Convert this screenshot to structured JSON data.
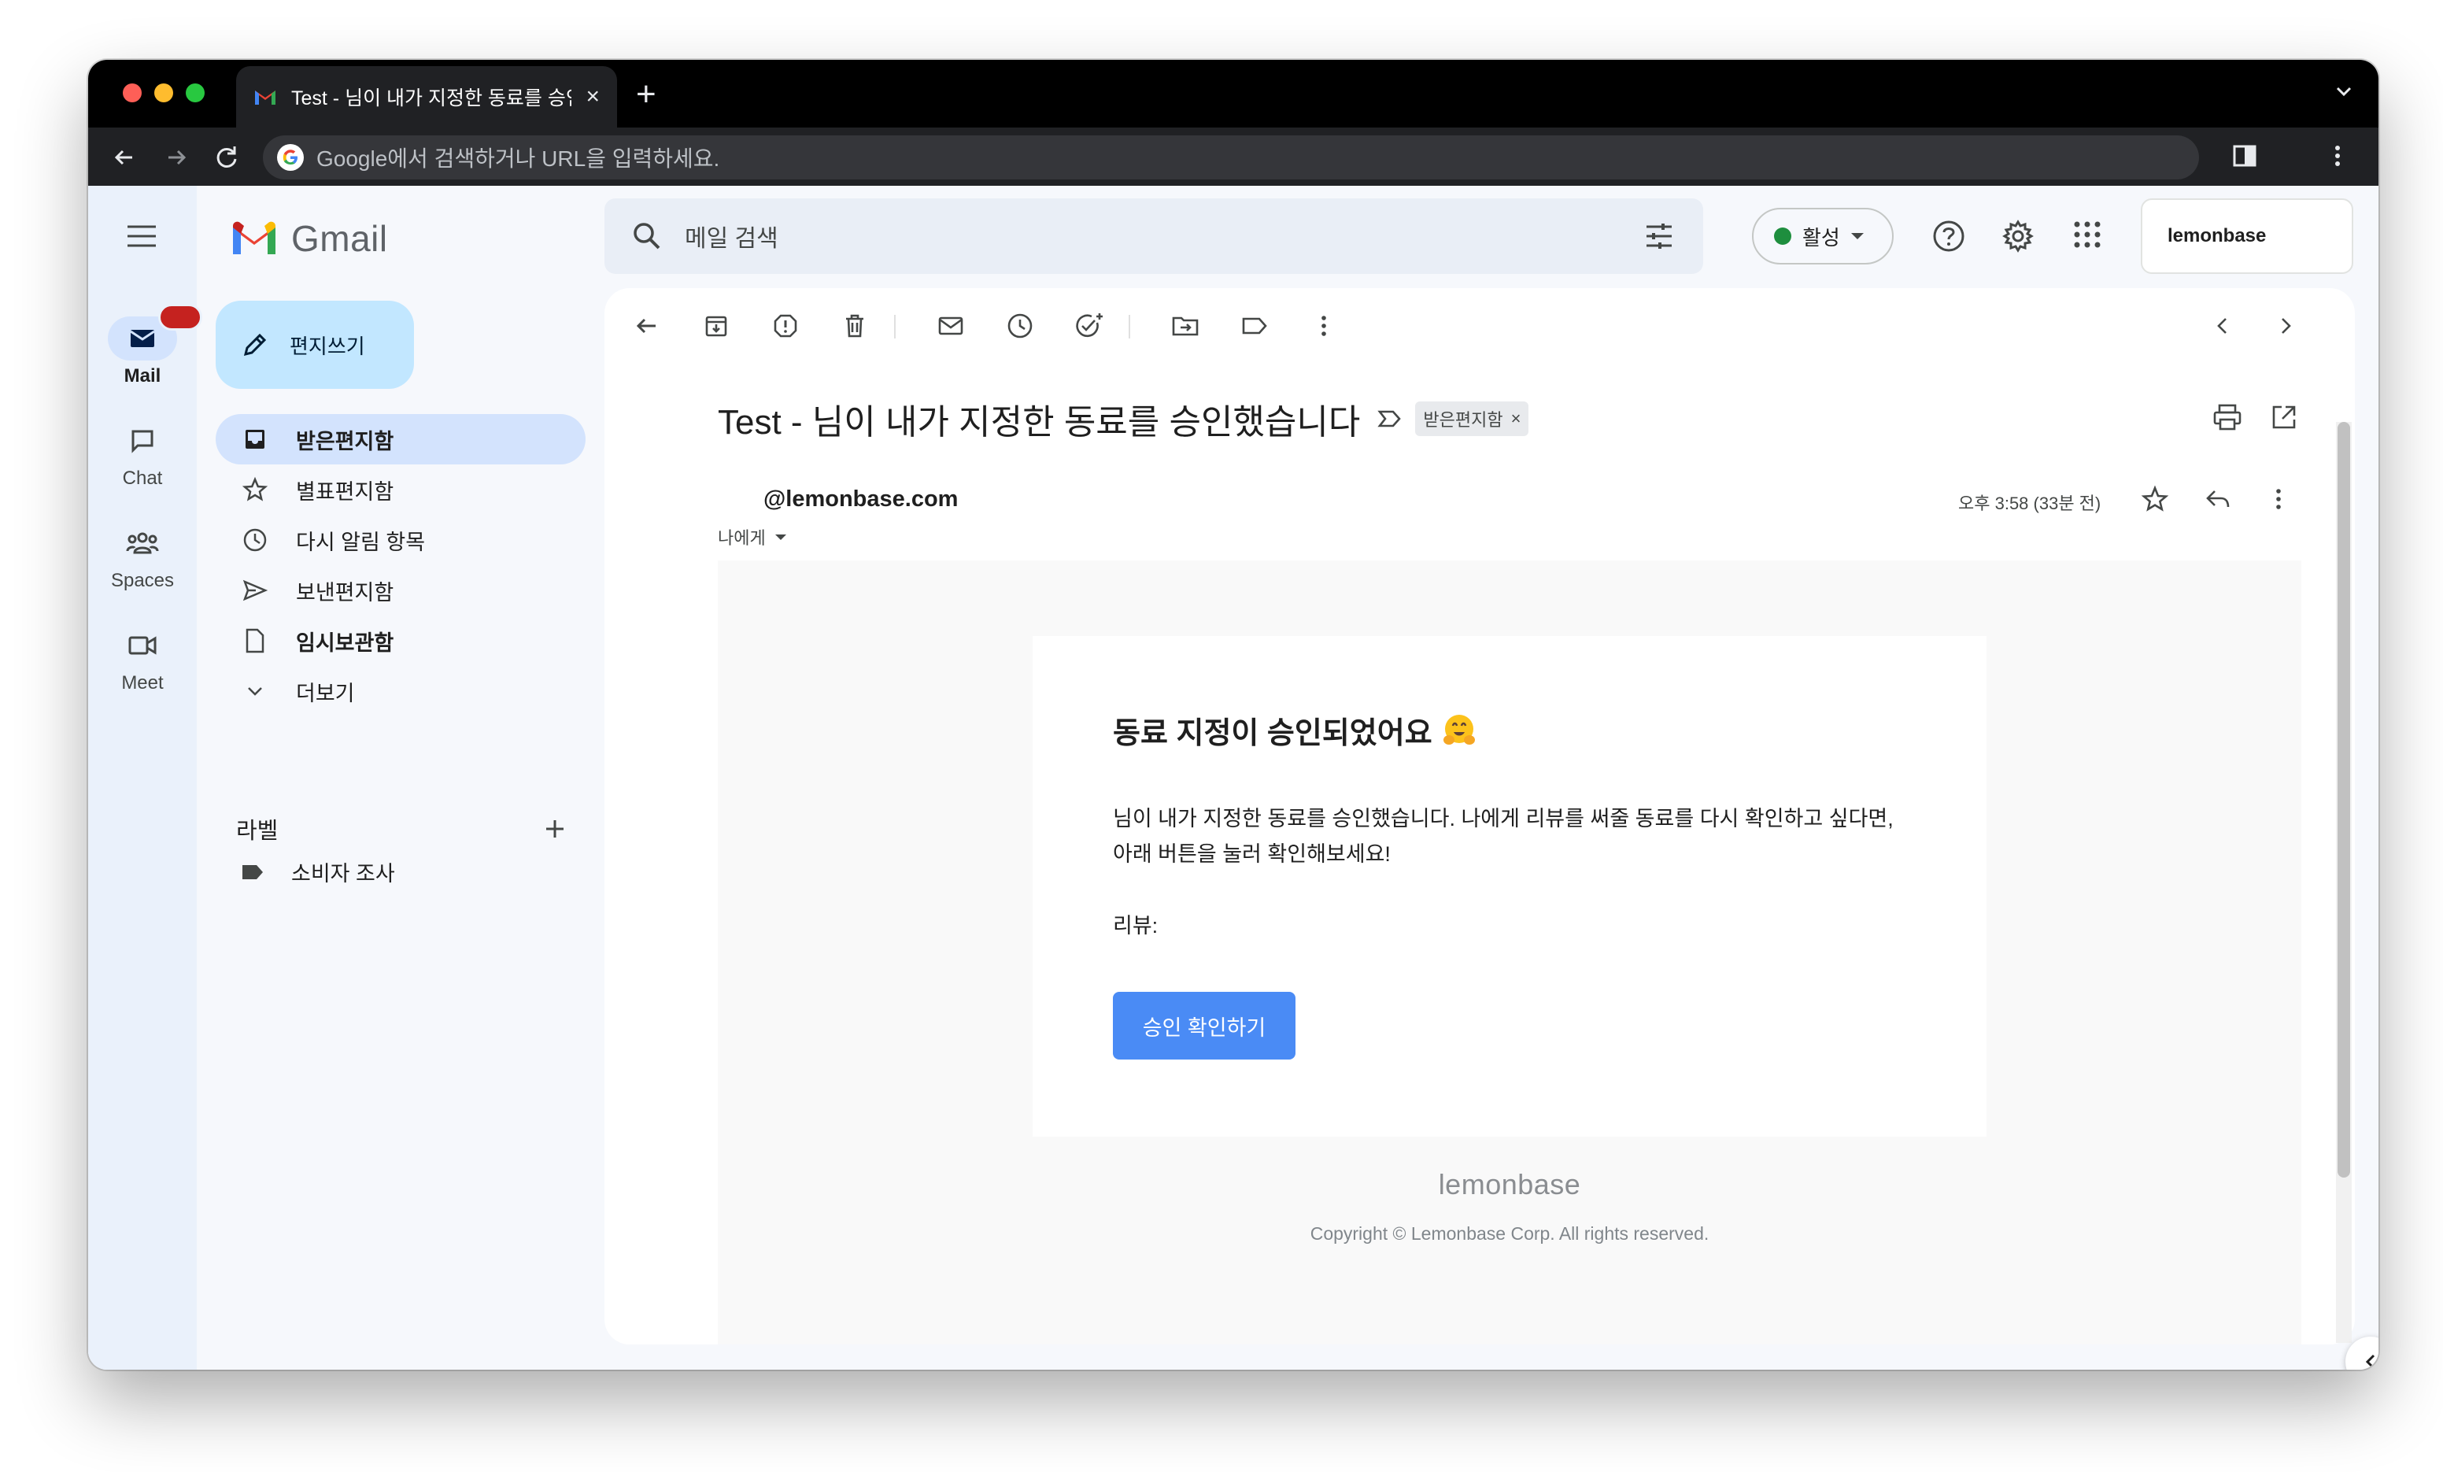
{
  "browser": {
    "tab_title": "Test - 님이 내가 지정한 동료를 승인했습니다",
    "address_placeholder": "Google에서 검색하거나 URL을 입력하세요."
  },
  "rail": {
    "items": [
      {
        "label": "Mail"
      },
      {
        "label": "Chat"
      },
      {
        "label": "Spaces"
      },
      {
        "label": "Meet"
      }
    ]
  },
  "brand": {
    "name": "Gmail"
  },
  "compose": {
    "label": "편지쓰기"
  },
  "folders": [
    {
      "label": "받은편지함",
      "icon": "inbox-icon"
    },
    {
      "label": "별표편지함",
      "icon": "star-icon"
    },
    {
      "label": "다시 알림 항목",
      "icon": "clock-icon"
    },
    {
      "label": "보낸편지함",
      "icon": "send-icon"
    },
    {
      "label": "임시보관함",
      "icon": "draft-icon"
    },
    {
      "label": "더보기",
      "icon": "chevron-down-icon"
    }
  ],
  "labels": {
    "heading": "라벨",
    "items": [
      {
        "label": "소비자 조사"
      }
    ]
  },
  "search": {
    "placeholder": "메일 검색"
  },
  "status": {
    "label": "활성",
    "color": "#1e8e3e"
  },
  "account": {
    "name": "lemonbase"
  },
  "message": {
    "subject": "Test - 님이 내가 지정한 동료를 승인했습니다",
    "label_chip": "받은편지함",
    "sender": "@lemonbase.com",
    "recipient": "나에게",
    "time": "오후 3:58 (33분 전)"
  },
  "email": {
    "title": "동료 지정이 승인되었어요",
    "body_line1": "님이 내가 지정한 동료를 승인했습니다. 나에게 리뷰를 써줄 동료를 다시 확인하고 싶다면,",
    "body_line2": "아래 버튼을 눌러 확인해보세요!",
    "review_label": "리뷰:",
    "button": "승인 확인하기",
    "footer_brand": "lemonbase",
    "footer_copy": "Copyright © Lemonbase Corp. All rights reserved."
  },
  "colors": {
    "compose_bg": "#c2e7ff",
    "active_folder_bg": "#d3e3fd",
    "email_button": "#4a8bf5",
    "badge": "#c5221f"
  }
}
